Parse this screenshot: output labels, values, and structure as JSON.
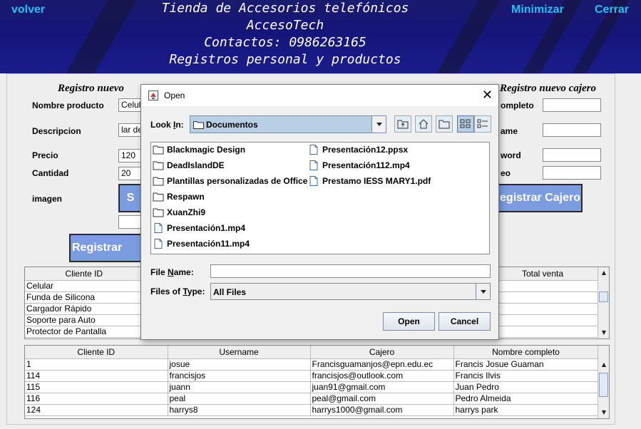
{
  "header": {
    "back": "volver",
    "minimize": "Minimizar",
    "close": "Cerrar",
    "titles": [
      "Tienda de Accesorios telefónicos",
      "AccesoTech",
      "Contactos: 0986263165",
      "Registros personal y productos"
    ]
  },
  "product_form": {
    "title": "Registro nuevo producto",
    "title_visible": "Registro nuevo",
    "labels": {
      "name": "Nombre producto",
      "description": "Descripcion",
      "price": "Precio",
      "quantity": "Cantidad",
      "image": "imagen"
    },
    "values": {
      "name": "Celul",
      "description": "lar de",
      "price": "120",
      "quantity": "20"
    },
    "select_button": "S",
    "register_button": "Registrar Pro"
  },
  "cashier_form": {
    "title": "Registro nuevo cajero",
    "title_visible": "Registro nuevo cajero",
    "labels": {
      "fullname": "ompleto",
      "username": "ame",
      "password": "word",
      "email": "eo"
    },
    "register_button": "egistrar Cajero"
  },
  "products_table": {
    "headers": [
      "Cliente ID",
      "Total venta"
    ],
    "rows": [
      "Celular",
      "Funda de Silicona",
      "Cargador Rápido",
      "Soporte para Auto",
      "Protector de Pantalla"
    ]
  },
  "cashiers_table": {
    "headers": [
      "Cliente ID",
      "Username",
      "Cajero",
      "Nombre completo"
    ],
    "rows": [
      [
        "1",
        "josue",
        "Francisguamanjos@epn.edu.ec",
        "Francis Josue Guaman"
      ],
      [
        "114",
        "francisjos",
        "francisjos@outlook.com",
        "Francis Ilvis"
      ],
      [
        "115",
        "juann",
        "juan91@gmail.com",
        "Juan Pedro"
      ],
      [
        "116",
        "peal",
        "peal@gmail.com",
        "Pedro Almeida"
      ],
      [
        "124",
        "harrys8",
        "harrys1000@gmail.com",
        "harrys park"
      ]
    ]
  },
  "dialog": {
    "title": "Open",
    "look_in_label": "Look In:",
    "look_in_value": "Documentos",
    "files_col1": [
      {
        "name": "Blackmagic Design",
        "kind": "folder"
      },
      {
        "name": "DeadIslandDE",
        "kind": "folder"
      },
      {
        "name": "Plantillas personalizadas de Office",
        "kind": "folder"
      },
      {
        "name": "Respawn",
        "kind": "folder"
      },
      {
        "name": "XuanZhi9",
        "kind": "folder"
      },
      {
        "name": "Presentación1.mp4",
        "kind": "file"
      },
      {
        "name": "Presentación11.mp4",
        "kind": "file"
      }
    ],
    "files_col2": [
      {
        "name": "Presentación12.ppsx",
        "kind": "file"
      },
      {
        "name": "Presentación112.mp4",
        "kind": "file"
      },
      {
        "name": "Prestamo IESS MARY1.pdf",
        "kind": "file"
      }
    ],
    "file_name_label": "File Name:",
    "file_name_value": "",
    "file_type_label": "Files of Type:",
    "file_type_value": "All Files",
    "open_button": "Open",
    "cancel_button": "Cancel"
  },
  "colors": {
    "link": "#19c4f0",
    "button": "#7b9ce0",
    "selection": "#b8cfe5"
  }
}
